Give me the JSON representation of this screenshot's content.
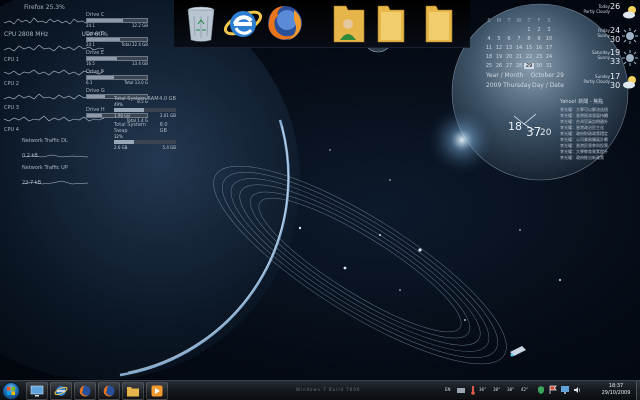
{
  "cpu": {
    "header_left": "Firefox 25.3%",
    "cores": [
      {
        "label": "CPU 2808 MHz",
        "extra": "Use 60%"
      },
      {
        "label": "CPU 1",
        "extra": ""
      },
      {
        "label": "CPU 2",
        "extra": ""
      },
      {
        "label": "CPU 3",
        "extra": ""
      },
      {
        "label": "CPU 4",
        "extra": ""
      }
    ]
  },
  "drives": [
    {
      "name": "Drive C",
      "left": "24.1",
      "right": "12.2 GB",
      "fill": 0.6
    },
    {
      "name": "Drive D",
      "left": "24.1",
      "right": "Total 22.4 GB",
      "fill": 0.55
    },
    {
      "name": "Drive E",
      "left": "16.5",
      "right": "13.4 GB",
      "fill": 0.5
    },
    {
      "name": "Drive F",
      "left": "6.1",
      "right": "Total 13.0 G",
      "fill": 0.45
    },
    {
      "name": "Drive G",
      "left": "",
      "right": "8.5 G",
      "fill": 0.3
    },
    {
      "name": "Drive H",
      "left": "",
      "right": "Total 1.4 G",
      "fill": 0.25
    }
  ],
  "memory": [
    {
      "title": "Total System RAM",
      "value": "4.0 GB",
      "pct": "49%",
      "left": "1.98 GB",
      "right": "2.01 GB",
      "fill": 0.49
    },
    {
      "title": "Total System Swap",
      "value": "8.0 GB",
      "pct": "32%",
      "left": "2.6 GB",
      "right": "5.4 GB",
      "fill": 0.32
    }
  ],
  "network": [
    {
      "title": "Network Traffic DL",
      "value": "0.2 kB"
    },
    {
      "title": "Network Traffic UP",
      "value": "22.7 kB"
    }
  ],
  "dock": {
    "items": [
      {
        "name": "recycle-bin",
        "icon": "recycle-bin-icon"
      },
      {
        "name": "internet-explorer",
        "icon": "ie-icon"
      },
      {
        "name": "firefox",
        "icon": "firefox-icon"
      },
      {
        "name": "user-folder",
        "icon": "user-folder-icon"
      },
      {
        "name": "folder-1",
        "icon": "folder-icon"
      },
      {
        "name": "folder-2",
        "icon": "folder-icon"
      }
    ]
  },
  "calendar": {
    "weekdays": [
      "S",
      "M",
      "T",
      "W",
      "T",
      "F",
      "S"
    ],
    "days": [
      "",
      "",
      "",
      "",
      "1",
      "2",
      "3",
      "4",
      "5",
      "6",
      "7",
      "8",
      "9",
      "10",
      "11",
      "12",
      "13",
      "14",
      "15",
      "16",
      "17",
      "18",
      "19",
      "20",
      "21",
      "22",
      "23",
      "24",
      "25",
      "26",
      "27",
      "28",
      "29",
      "30",
      "31"
    ],
    "today": "29",
    "year_month_label": "Year / Month",
    "month_day": "October 29",
    "year_weekday": "2009 Thursday",
    "day_date_label": "Day / Date"
  },
  "clock": {
    "hour": "18",
    "minute": "37",
    "second": "20"
  },
  "chinese_panel": {
    "title": "Yahoo! 新聞 - 焦點",
    "lines": [
      "李光耀：大學可以解決這個",
      "李光耀：香港經濟發展持續",
      "李光耀：台灣官員訪問國外",
      "李光耀：香港政治民主化",
      "李光耀：政府財政政策穩定",
      "李光耀：公司業務擴展計劃",
      "李光耀：香港民眾參與投票",
      "李光耀：大學教育質素提升",
      "李光耀：政府推出新政策"
    ]
  },
  "weather": [
    {
      "day": "Today",
      "cond": "Partly Cloudy",
      "hi": "26",
      "lo": "",
      "icon": "partly-cloudy-icon"
    },
    {
      "day": "Friday",
      "cond": "Sunny",
      "hi": "24",
      "lo": "30",
      "icon": "sunny-icon"
    },
    {
      "day": "Saturday",
      "cond": "Sunny",
      "hi": "19",
      "lo": "33",
      "icon": "sunny-icon"
    },
    {
      "day": "Sunday",
      "cond": "Partly Cloudy",
      "hi": "17",
      "lo": "30",
      "icon": "partly-cloudy-icon"
    }
  ],
  "taskbar": {
    "center_text": "Windows 7 Build 7600",
    "tray_lang": "EN",
    "tray_temps": [
      "36°",
      "38°",
      "38°",
      "42°"
    ],
    "time": "18:37",
    "date": "29/10/2009"
  },
  "colors": {
    "accent": "#1d6fb8",
    "folder": "#e7b64a",
    "ff_orange": "#e8741c"
  }
}
